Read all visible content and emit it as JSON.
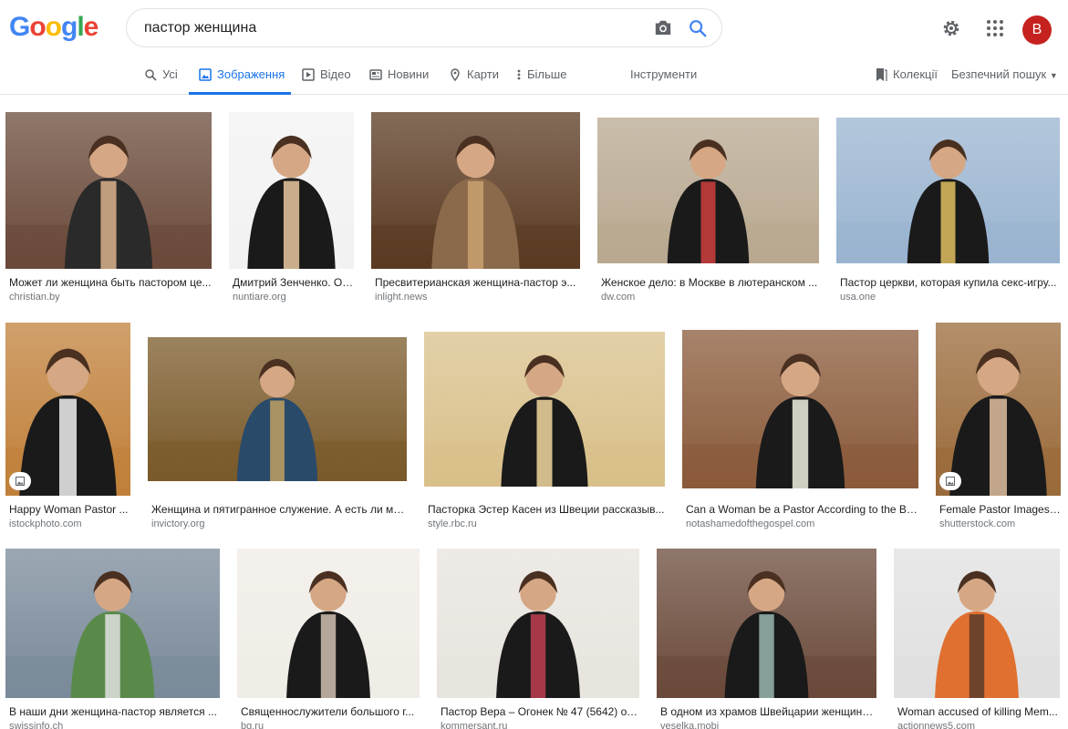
{
  "logo": [
    "G",
    "o",
    "o",
    "g",
    "l",
    "e"
  ],
  "logo_colors": [
    "#4285f4",
    "#ea4335",
    "#fbbc05",
    "#4285f4",
    "#34a853",
    "#ea4335"
  ],
  "search": {
    "value": "пастор женщина"
  },
  "account": {
    "initial": "B"
  },
  "tabs": [
    {
      "label": "Усі",
      "icon": "search-icon"
    },
    {
      "label": "Зображення",
      "icon": "image-icon",
      "active": true
    },
    {
      "label": "Відео",
      "icon": "video-icon"
    },
    {
      "label": "Новини",
      "icon": "news-icon"
    },
    {
      "label": "Карти",
      "icon": "map-pin-icon"
    },
    {
      "label": "Більше",
      "icon": "more-vert-icon"
    }
  ],
  "tools_label": "Інструменти",
  "collections_label": "Колекції",
  "safesearch_label": "Безпечний пошук",
  "accent_color": "#1a73e8",
  "results": [
    {
      "caption": "Может ли женщина быть пастором це...",
      "source": "christian.by",
      "colors": [
        "#6a4a3a",
        "#2a2a2a",
        "#d9b38c"
      ]
    },
    {
      "caption": "Дмитрий Зенченко. О ...",
      "source": "nuntiare.org",
      "colors": [
        "#f2f2f2",
        "#1a1a1a",
        "#e9c9a0"
      ]
    },
    {
      "caption": "Пресвитерианская женщина-пастор э...",
      "source": "inlight.news",
      "colors": [
        "#5a3a22",
        "#8a6a4a",
        "#c9a070"
      ]
    },
    {
      "caption": "Женское дело: в Москве в лютеранском ...",
      "source": "dw.com",
      "colors": [
        "#b8a890",
        "#1a1a1a",
        "#d04040"
      ]
    },
    {
      "caption": "Пастор церкви, которая купила секс-игру...",
      "source": "usa.one",
      "colors": [
        "#9ab4d0",
        "#1a1a1a",
        "#e0c060"
      ]
    },
    {
      "caption": "Happy Woman Pastor ...",
      "source": "istockphoto.com",
      "colors": [
        "#c0803a",
        "#1a1a1a",
        "#f0f0f0"
      ]
    },
    {
      "caption": "Женщина и пятигранное служение. А есть ли ме...",
      "source": "invictory.org",
      "colors": [
        "#7a5a2a",
        "#2a4a6a",
        "#c0a060"
      ]
    },
    {
      "caption": "Пасторка Эстер Касен из Швеции рассказыв...",
      "source": "style.rbc.ru",
      "colors": [
        "#d9c08a",
        "#1a1a1a",
        "#f2d8a0"
      ]
    },
    {
      "caption": "Can a Woman be a Pastor According to the Bib...",
      "source": "notashamedofthegospel.com",
      "colors": [
        "#8a5a3a",
        "#1a1a1a",
        "#f2f0e0"
      ]
    },
    {
      "caption": "Female Pastor Images,...",
      "source": "shutterstock.com",
      "colors": [
        "#9a6a3a",
        "#1a1a1a",
        "#e0c0a0"
      ]
    },
    {
      "caption": "В наши дни женщина-пастор является ...",
      "source": "swissinfo.ch",
      "colors": [
        "#7a8a9a",
        "#5a8a4a",
        "#e0e0e0"
      ]
    },
    {
      "caption": "Священнослужители большого г...",
      "source": "bg.ru",
      "colors": [
        "#f0ece6",
        "#1a1a1a",
        "#d0c0b0"
      ]
    },
    {
      "caption": "Пастор Вера – Огонек № 47 (5642) от...",
      "source": "kommersant.ru",
      "colors": [
        "#e8e4de",
        "#1a1a1a",
        "#c04050"
      ]
    },
    {
      "caption": "В одном из храмов Швейцарии женщина...",
      "source": "veselka.mobi",
      "colors": [
        "#6a4a3a",
        "#1a1a1a",
        "#9ab8b0"
      ]
    },
    {
      "caption": "Woman accused of killing Mem...",
      "source": "actionnews5.com",
      "colors": [
        "#e0e0e0",
        "#e07030",
        "#5a3a2a"
      ]
    }
  ]
}
